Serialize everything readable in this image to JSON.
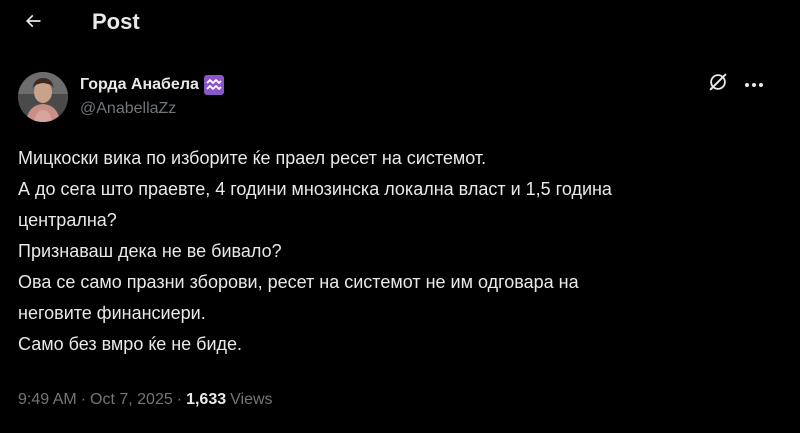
{
  "header": {
    "title": "Post"
  },
  "author": {
    "display_name": "Горда Анабела",
    "badge_icon": "aquarius-sign-icon",
    "badge_color": "#8a56c9",
    "handle": "@AnabellaZz"
  },
  "actions": {
    "grok_icon": "grok-icon",
    "more_icon": "more-horizontal-icon"
  },
  "post": {
    "lines": [
      "Мицкоски вика по изборите ќе праел ресет на системот.",
      "А до сега што праевте, 4 години мнозинска локална власт и 1,5 година",
      "централна?",
      "Признаваш дека не ве бивало?",
      "Ова се само празни зборови, ресет на системот не им одговара на",
      "неговите финансиери.",
      "Само без вмро ќе не биде."
    ]
  },
  "meta": {
    "time": "9:49 AM",
    "separator": "·",
    "date": "Oct 7, 2025",
    "views_count": "1,633",
    "views_label": "Views"
  },
  "colors": {
    "background": "#000000",
    "primary_text": "#e7e9ea",
    "secondary_text": "#71767b"
  }
}
